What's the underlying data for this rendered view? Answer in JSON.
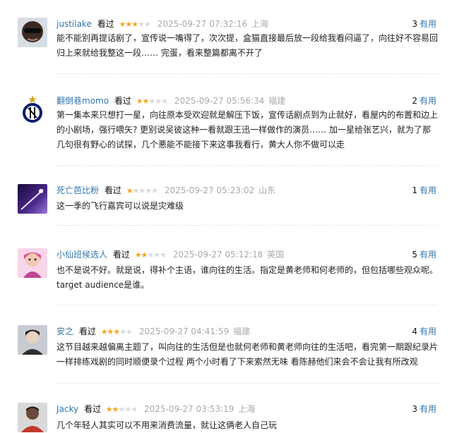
{
  "comments": [
    {
      "user": "justilake",
      "watched": "看过",
      "rating": 3,
      "time": "2025-09-27 07:32:16",
      "location": "上海",
      "votes": "3",
      "useful": "有用",
      "text": "能不能别再提话剧了，宣传说一嘴得了，次次提，盒猫直接最后放一段给我看闷逼了，向往好不容易回归上来就给我整这一段…… 完蛋，看来整篇都离不开了"
    },
    {
      "user": "翻倒巷momo",
      "watched": "看过",
      "rating": 2,
      "time": "2025-09-27 05:56:34",
      "location": "福建",
      "votes": "2",
      "useful": "有用",
      "text": "第一集本来只想打一星，向往原本受欢迎就是解压下饭，宣传话剧点到为止就好，看屋内的布置和边上的小剧场，强行喂矢? 更别说吴彼这种一看就跟王迅一样做作的演员…… 加一星给张艺兴，就为了那几句很有野心的试探，几个悪能不能接下来这事我看行，黄大人你不做可以走"
    },
    {
      "user": "死亡芭比粉",
      "watched": "看过",
      "rating": 1,
      "time": "2025-09-27 05:23:02",
      "location": "山东",
      "votes": "1",
      "useful": "有用",
      "text": "这一季的飞行嘉宾可以说是灾难级"
    },
    {
      "user": "小仙班候选人",
      "watched": "看过",
      "rating": 2,
      "time": "2025-09-27 05:12:18",
      "location": "英国",
      "votes": "5",
      "useful": "有用",
      "text": "也不是说不好。就是说，得补个主语，谁向往的生活。指定是黄老师和何老师的，但包括哪些观众呢。target audience是谁。"
    },
    {
      "user": "安之",
      "watched": "看过",
      "rating": 3,
      "time": "2025-09-27 04:41:59",
      "location": "福建",
      "votes": "4",
      "useful": "有用",
      "text": "这节目越来越偏离主题了，叫向往的生活但是也就何老师和黄老师向往的生活吧，看完第一期跟纪录片一样排练戏剧的同时顺便录个过程 两个小时看了下来索然无味 看陈赫他们来会不会让我有所改观"
    },
    {
      "user": "Jacky",
      "watched": "看过",
      "rating": 2,
      "time": "2025-09-27 03:53:19",
      "location": "上海",
      "votes": "3",
      "useful": "有用",
      "text": "几个年轻人其实可以不用来消费流量，就让这俩老人自己玩"
    }
  ],
  "avatars": [
    "person-with-sunglasses",
    "inter-milan-crest",
    "purple-sky-image",
    "anime-girl-pink",
    "boy-portrait",
    "man-red-shirt"
  ]
}
